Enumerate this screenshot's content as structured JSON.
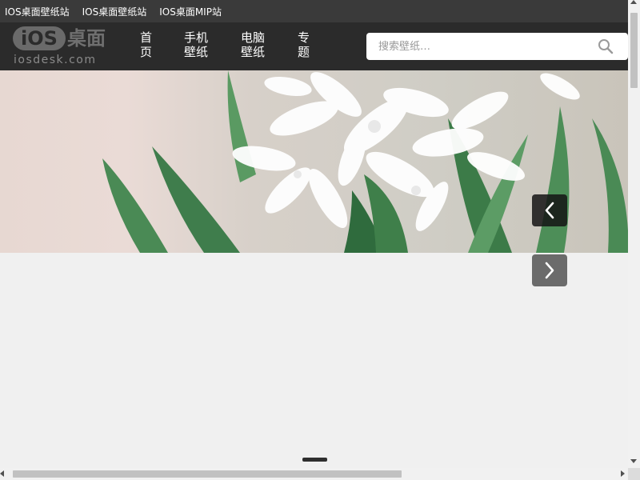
{
  "topbar": {
    "links": [
      "IOS桌面壁纸站",
      "IOS桌面壁纸站",
      "IOS桌面MIP站"
    ]
  },
  "logo": {
    "badge": "iOS",
    "cn": "桌面",
    "domain": "iosdesk.com"
  },
  "nav": {
    "items": [
      "首页",
      "手机壁纸",
      "电脑壁纸",
      "专题"
    ]
  },
  "search": {
    "placeholder": "搜索壁纸…",
    "icon": "search-icon"
  },
  "banner": {
    "prev_icon": "chevron-left-icon",
    "next_icon": "chevron-right-icon"
  },
  "colors": {
    "topbar_bg": "#3a3a3a",
    "header_bg": "#2b2b2b",
    "page_bg": "#f0f0f0"
  }
}
